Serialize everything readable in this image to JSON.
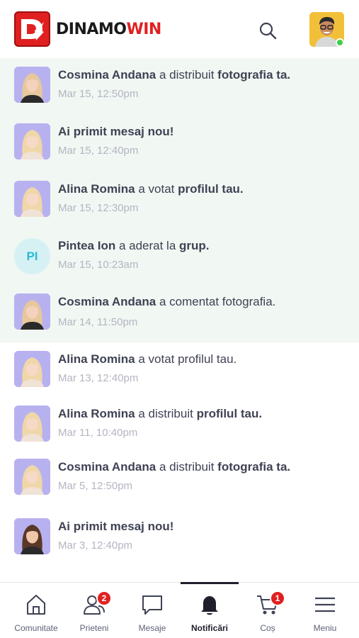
{
  "header": {
    "logo_mark": "D",
    "brand_first": "DINAMO",
    "brand_second": "WIN",
    "brand_color": "#e02020",
    "search_icon": "search-icon",
    "user_status": "online"
  },
  "notifications": [
    {
      "unread": true,
      "avatar": "photo",
      "parts": [
        {
          "t": "Cosmina Andana",
          "b": true
        },
        {
          "t": " a distribuit ",
          "b": false
        },
        {
          "t": "fotografia ta.",
          "b": true
        }
      ],
      "time": "Mar 15, 12:50pm"
    },
    {
      "unread": true,
      "avatar": "photo",
      "parts": [
        {
          "t": "Ai primit mesaj nou!",
          "b": true
        }
      ],
      "time": "Mar 15, 12:40pm"
    },
    {
      "unread": true,
      "avatar": "photo",
      "parts": [
        {
          "t": "Alina Romina",
          "b": true
        },
        {
          "t": " a votat ",
          "b": false
        },
        {
          "t": "profilul tau.",
          "b": true
        }
      ],
      "time": "Mar 15, 12:30pm"
    },
    {
      "unread": true,
      "avatar": "initials",
      "initials": "PI",
      "parts": [
        {
          "t": "Pintea Ion",
          "b": true
        },
        {
          "t": " a aderat la ",
          "b": false
        },
        {
          "t": "grup.",
          "b": true
        }
      ],
      "time": "Mar 15, 10:23am"
    },
    {
      "unread": true,
      "avatar": "photo",
      "parts": [
        {
          "t": "Cosmina Andana",
          "b": true
        },
        {
          "t": " a comentat fotografia.",
          "b": false
        }
      ],
      "time": "Mar 14, 11:50pm"
    },
    {
      "unread": false,
      "avatar": "photo",
      "parts": [
        {
          "t": "Alina Romina",
          "b": true
        },
        {
          "t": " a votat profilul tau.",
          "b": false
        }
      ],
      "time": "Mar 13, 12:40pm"
    },
    {
      "unread": false,
      "avatar": "photo",
      "parts": [
        {
          "t": "Alina Romina",
          "b": true
        },
        {
          "t": " a distribuit ",
          "b": false
        },
        {
          "t": "profilul tau.",
          "b": true
        }
      ],
      "time": "Mar 11, 10:40pm"
    },
    {
      "unread": false,
      "avatar": "photo",
      "parts": [
        {
          "t": "Cosmina Andana",
          "b": true
        },
        {
          "t": " a distribuit ",
          "b": false
        },
        {
          "t": "fotografia ta.",
          "b": true
        }
      ],
      "time": "Mar 5, 12:50pm"
    },
    {
      "unread": false,
      "avatar": "photo",
      "parts": [
        {
          "t": "Ai primit mesaj nou!",
          "b": true
        }
      ],
      "time": "Mar 3, 12:40pm"
    }
  ],
  "tabbar": {
    "tabs": [
      {
        "id": "comunitate",
        "label": "Comunitate",
        "icon": "home-icon",
        "badge": ""
      },
      {
        "id": "prieteni",
        "label": "Prieteni",
        "icon": "friends-icon",
        "badge": "2"
      },
      {
        "id": "mesaje",
        "label": "Mesaje",
        "icon": "chat-icon",
        "badge": ""
      },
      {
        "id": "notificari",
        "label": "Notificări",
        "icon": "bell-icon",
        "badge": "",
        "active": true
      },
      {
        "id": "cos",
        "label": "Coș",
        "icon": "cart-icon",
        "badge": "1"
      },
      {
        "id": "meniu",
        "label": "Meniu",
        "icon": "menu-icon",
        "badge": ""
      }
    ]
  }
}
